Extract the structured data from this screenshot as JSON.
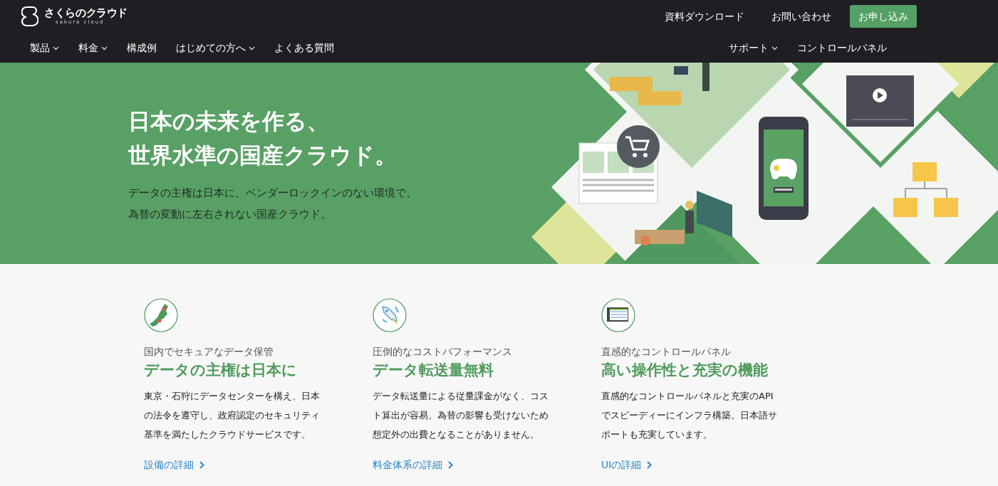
{
  "header": {
    "logo": {
      "name": "さくらのクラウド",
      "subtitle": "sakura cloud"
    },
    "top_links": [
      "資料ダウンロード",
      "お問い合わせ"
    ],
    "cta": "お申し込み",
    "nav": [
      {
        "label": "製品",
        "dropdown": true
      },
      {
        "label": "料金",
        "dropdown": true
      },
      {
        "label": "構成例",
        "dropdown": false
      },
      {
        "label": "はじめての方へ",
        "dropdown": true
      },
      {
        "label": "よくある質問",
        "dropdown": false
      }
    ],
    "nav_right": [
      {
        "label": "サポート",
        "dropdown": true
      },
      {
        "label": "コントロールパネル",
        "dropdown": false
      }
    ]
  },
  "hero": {
    "title_lines": [
      "日本の未来を作る、",
      "世界水準の国産クラウド。"
    ],
    "description_lines": [
      "データの主権は日本に、ベンダーロックインのない環境で、",
      "為替の変動に左右されない国産クラウド。"
    ]
  },
  "features": [
    {
      "kind": "map",
      "eyebrow": "国内でセキュアなデータ保管",
      "title": "データの主権は日本に",
      "lines": [
        "東京・石狩にデータセンターを構え、日本",
        "の法令を遵守し、政府認定のセキュリティ",
        "基準を満たしたクラウドサービスです。"
      ],
      "link": "設備の詳細"
    },
    {
      "kind": "rocket",
      "eyebrow": "圧倒的なコストパフォーマンス",
      "title": "データ転送量無料",
      "lines": [
        "データ転送量による従量課金がなく、コス",
        "ト算出が容易。為替の影響も受けないため",
        "想定外の出費となることがありません。"
      ],
      "link": "料金体系の詳細"
    },
    {
      "kind": "screen",
      "eyebrow": "直感的なコントロールパネル",
      "title": "高い操作性と充実の機能",
      "lines": [
        "直感的なコントロールパネルと充実のAPI",
        "でスピーディーにインフラ構築。日本語サ",
        "ポートも充実しています。"
      ],
      "link": "UIの詳細"
    }
  ]
}
